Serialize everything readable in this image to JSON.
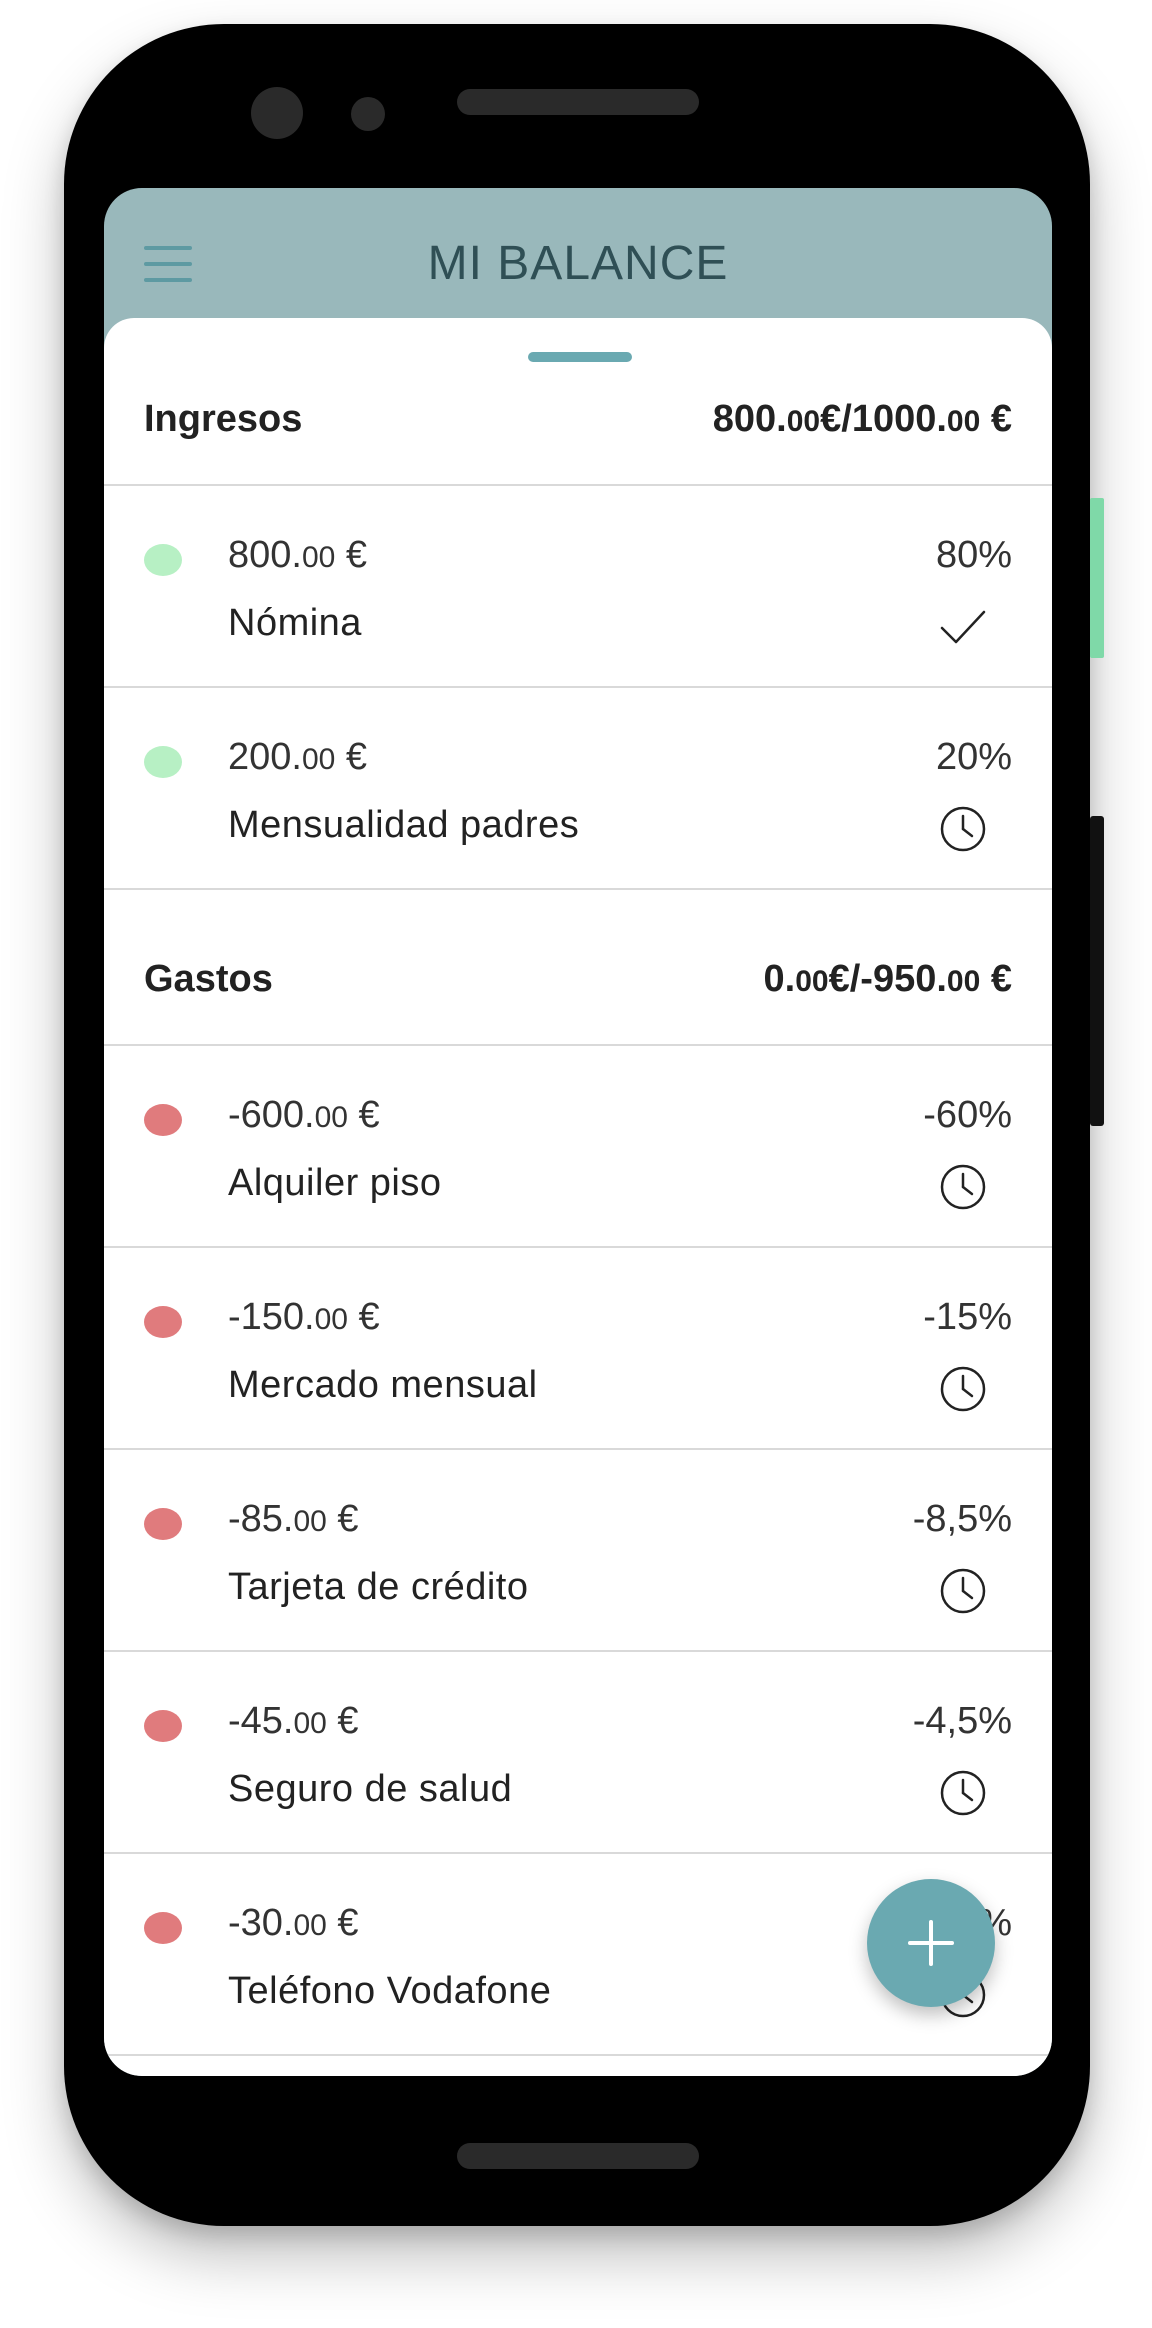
{
  "app": {
    "title": "MI BALANCE"
  },
  "sections": [
    {
      "title": "Ingresos",
      "total_main": "800.",
      "total_small": "00",
      "total_mid": "€/1000.",
      "total_small2": "00",
      "total_end": " €",
      "items": [
        {
          "amount_main": "800.",
          "amount_small": "00",
          "amount_end": " €",
          "label": "Nómina",
          "percent": "80%",
          "status": "check-icon",
          "dot_color": "#b7f0c4"
        },
        {
          "amount_main": "200.",
          "amount_small": "00",
          "amount_end": " €",
          "label": "Mensualidad padres",
          "percent": "20%",
          "status": "clock-icon",
          "dot_color": "#b7f0c4"
        }
      ]
    },
    {
      "title": "Gastos",
      "total_main": "0.",
      "total_small": "00",
      "total_mid": "€/-950.",
      "total_small2": "00",
      "total_end": " €",
      "items": [
        {
          "amount_main": "-600.",
          "amount_small": "00",
          "amount_end": " €",
          "label": "Alquiler piso",
          "percent": "-60%",
          "status": "clock-icon",
          "dot_color": "#e07b7d"
        },
        {
          "amount_main": "-150.",
          "amount_small": "00",
          "amount_end": " €",
          "label": "Mercado mensual",
          "percent": "-15%",
          "status": "clock-icon",
          "dot_color": "#e07b7d"
        },
        {
          "amount_main": "-85.",
          "amount_small": "00",
          "amount_end": " €",
          "label": "Tarjeta de crédito",
          "percent": "-8,5%",
          "status": "clock-icon",
          "dot_color": "#e07b7d"
        },
        {
          "amount_main": "-45.",
          "amount_small": "00",
          "amount_end": " €",
          "label": "Seguro de salud",
          "percent": "-4,5%",
          "status": "clock-icon",
          "dot_color": "#e07b7d"
        },
        {
          "amount_main": "-30.",
          "amount_small": "00",
          "amount_end": " €",
          "label": "Teléfono Vodafone",
          "percent": "%",
          "status": "clock-icon",
          "dot_color": "#e07b7d"
        }
      ]
    }
  ],
  "colors": {
    "accent": "#6aa9b1",
    "appbar": "#99b8bb",
    "income_dot": "#b7f0c4",
    "expense_dot": "#e07b7d"
  },
  "fab": {
    "icon": "plus-icon"
  }
}
